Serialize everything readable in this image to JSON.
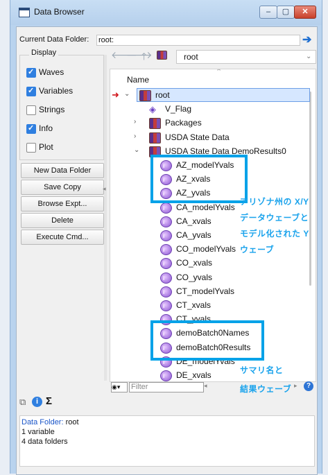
{
  "window": {
    "title": "Data Browser",
    "controls": [
      "–",
      "▢",
      "✕"
    ]
  },
  "current_data_folder": {
    "label": "Current Data Folder:",
    "value": "root:"
  },
  "display": {
    "legend": "Display",
    "checkboxes": [
      {
        "label": "Waves",
        "checked": true
      },
      {
        "label": "Variables",
        "checked": true
      },
      {
        "label": "Strings",
        "checked": false
      },
      {
        "label": "Info",
        "checked": true
      },
      {
        "label": "Plot",
        "checked": false
      }
    ]
  },
  "buttons": [
    "New Data Folder",
    "Save Copy",
    "Browse Expt...",
    "Delete",
    "Execute Cmd..."
  ],
  "nav": {
    "folder_select": "root",
    "icons": [
      "back-icon",
      "forward-icon",
      "up-icon",
      "folder-icon"
    ]
  },
  "tree": {
    "column_header": "Name",
    "rows": [
      {
        "label": "root",
        "kind": "folder",
        "twisty": "⌄",
        "selected": true
      },
      {
        "label": "V_Flag",
        "kind": "variable"
      },
      {
        "label": "Packages",
        "kind": "folder",
        "twisty": "›"
      },
      {
        "label": "USDA State Data",
        "kind": "folder",
        "twisty": "›"
      },
      {
        "label": "USDA State Data DemoResults0",
        "kind": "folder",
        "twisty": "⌄"
      },
      {
        "label": "AZ_modelYvals",
        "kind": "wave"
      },
      {
        "label": "AZ_xvals",
        "kind": "wave"
      },
      {
        "label": "AZ_yvals",
        "kind": "wave"
      },
      {
        "label": "CA_modelYvals",
        "kind": "wave"
      },
      {
        "label": "CA_xvals",
        "kind": "wave"
      },
      {
        "label": "CA_yvals",
        "kind": "wave"
      },
      {
        "label": "CO_modelYvals",
        "kind": "wave"
      },
      {
        "label": "CO_xvals",
        "kind": "wave"
      },
      {
        "label": "CO_yvals",
        "kind": "wave"
      },
      {
        "label": "CT_modelYvals",
        "kind": "wave"
      },
      {
        "label": "CT_xvals",
        "kind": "wave"
      },
      {
        "label": "CT_yvals",
        "kind": "wave"
      },
      {
        "label": "demoBatch0Names",
        "kind": "text-wave"
      },
      {
        "label": "demoBatch0Results",
        "kind": "wave"
      },
      {
        "label": "DE_modelYvals",
        "kind": "wave"
      },
      {
        "label": "DE_xvals",
        "kind": "wave"
      }
    ]
  },
  "filter": {
    "placeholder": "Filter"
  },
  "info_panel": {
    "folder_label": "Data Folder:",
    "folder_value": "root",
    "line2": "1 variable",
    "line3": "4 data folders"
  },
  "annotations": {
    "note1": [
      "アリゾナ州の X/Y",
      "データウェーブと",
      "モデル化された Y",
      "ウェーブ"
    ],
    "note2": [
      "サマリ名と",
      "結果ウェーブ"
    ],
    "highlight_color": "#00a2e8"
  },
  "colors": {
    "accent": "#2f7fe0",
    "selection": "#d6e7ff",
    "pointer_arrow": "#d1151b"
  }
}
